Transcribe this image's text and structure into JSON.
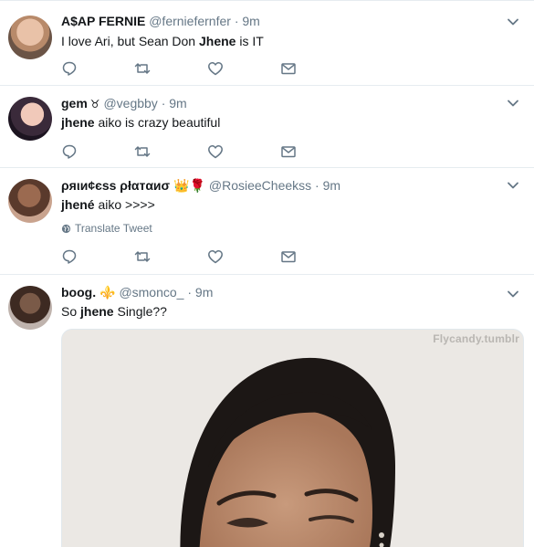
{
  "tweets": [
    {
      "name": "A$AP FERNIE",
      "handle": "@ferniefernfer",
      "dot": "·",
      "time": "9m",
      "text_pre": "I love Ari, but Sean Don ",
      "text_bold": "Jhene",
      "text_post": " is IT"
    },
    {
      "name": "gem",
      "badge": "♉",
      "handle": "@vegbby",
      "dot": "·",
      "time": "9m",
      "text_pre": "",
      "text_bold": "jhene",
      "text_post": " aiko is crazy beautiful"
    },
    {
      "name": "ρяιи¢єѕѕ ρłαтαиσ",
      "emoji": "👑🌹",
      "handle": "@RosieeCheekss",
      "dot": "·",
      "time": "9m",
      "text_pre": "",
      "text_bold": "jhené",
      "text_post": " aiko >>>>",
      "translate": "Translate Tweet"
    },
    {
      "name": "boog.",
      "emoji": "⚜️",
      "handle": "@smonco_",
      "dot": "·",
      "time": "9m",
      "text_pre": "So ",
      "text_bold": "jhene",
      "text_post": " Single??",
      "media_watermark": "Flycandy.tumblr"
    }
  ],
  "icons": {
    "reply": "reply-icon",
    "retweet": "retweet-icon",
    "like": "heart-icon",
    "message": "envelope-icon",
    "caret": "chevron-down-icon",
    "globe": "globe-icon"
  },
  "colors": {
    "text": "#14171a",
    "secondary": "#657786",
    "divider": "#e6ecf0"
  }
}
